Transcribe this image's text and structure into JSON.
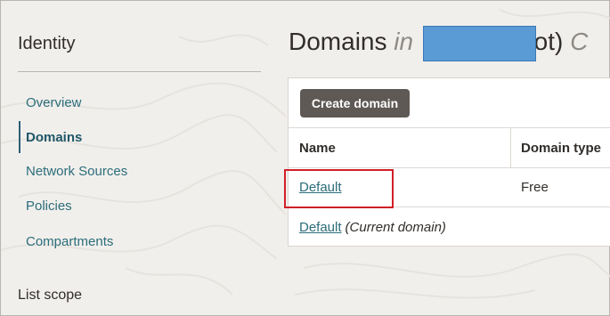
{
  "sidebar": {
    "title": "Identity",
    "items": [
      {
        "label": "Overview"
      },
      {
        "label": "Domains"
      },
      {
        "label": "Network Sources"
      },
      {
        "label": "Policies"
      },
      {
        "label": "Compartments"
      }
    ],
    "active_item": "Domains",
    "list_scope_label": "List scope"
  },
  "main": {
    "title_prefix": "Domains",
    "title_italic_visible": "in",
    "title_suffix_visible": "oot)",
    "title_trailing_italic": "C",
    "create_button_label": "Create domain",
    "table": {
      "columns": [
        "Name",
        "Domain type"
      ],
      "rows": [
        {
          "name": "Default",
          "domain_type": "Free",
          "note": ""
        },
        {
          "name": "Default",
          "domain_type": "",
          "note": "(Current domain)"
        }
      ]
    }
  },
  "colors": {
    "link": "#2b6d7a",
    "button_bg": "#5f5955",
    "highlight": "#d11f26",
    "redaction": "#5b9bd5"
  }
}
